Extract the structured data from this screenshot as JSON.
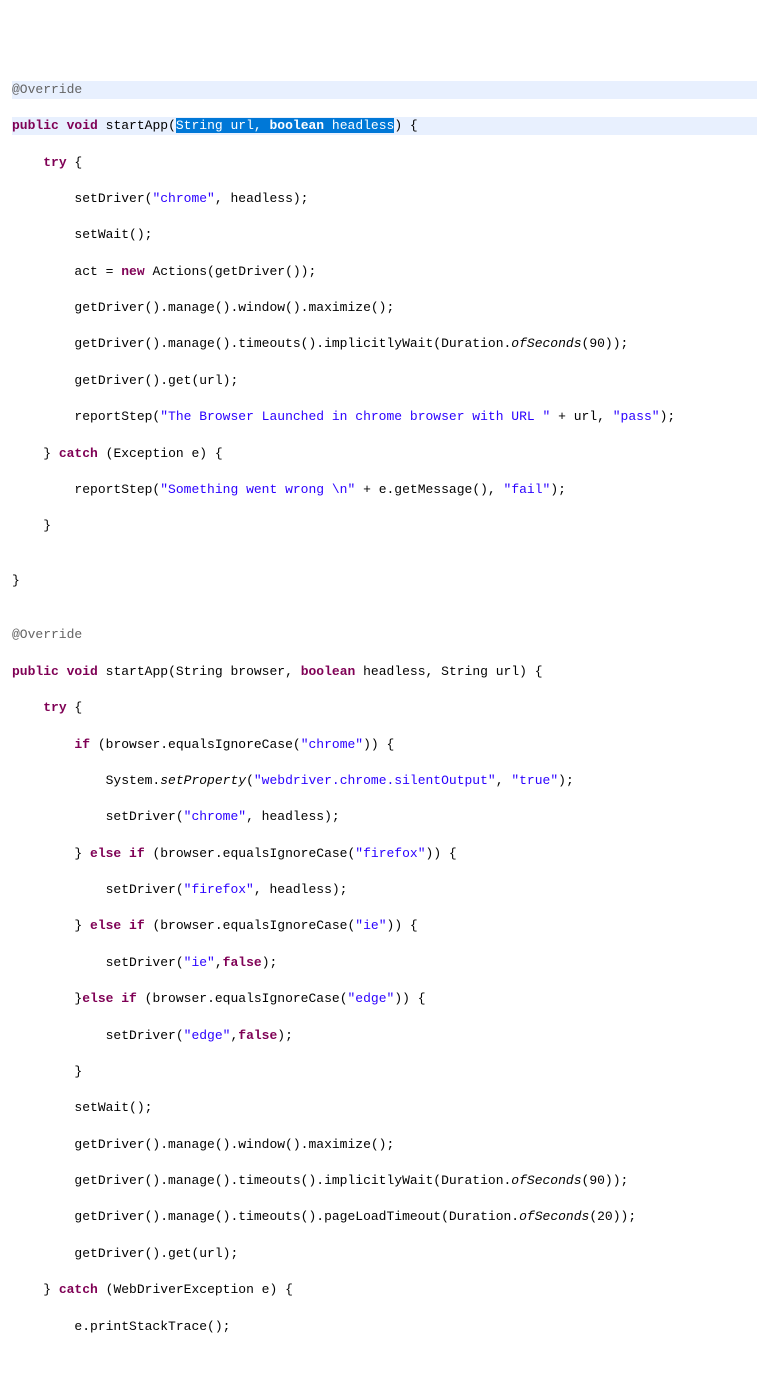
{
  "code": {
    "lines": [
      {
        "indent": 0,
        "tokens": [
          {
            "t": "annotation",
            "v": "@Override"
          }
        ],
        "firstLine": true
      },
      {
        "indent": 0,
        "tokens": [
          {
            "t": "keyword",
            "v": "public"
          },
          {
            "t": "sp",
            "v": " "
          },
          {
            "t": "keyword",
            "v": "void"
          },
          {
            "t": "sp",
            "v": " "
          },
          {
            "t": "method",
            "v": "startApp("
          },
          {
            "t": "selected",
            "v": "String url, "
          },
          {
            "t": "selected-keyword",
            "v": "boolean"
          },
          {
            "t": "selected",
            "v": " headless"
          },
          {
            "t": "method",
            "v": ") {"
          }
        ],
        "firstLine": true
      },
      {
        "indent": 1,
        "tokens": [
          {
            "t": "keyword",
            "v": "try"
          },
          {
            "t": "sp",
            "v": " {"
          }
        ]
      },
      {
        "indent": 2,
        "tokens": [
          {
            "t": "method",
            "v": "setDriver("
          },
          {
            "t": "string",
            "v": "\"chrome\""
          },
          {
            "t": "method",
            "v": ", headless);"
          }
        ]
      },
      {
        "indent": 2,
        "tokens": [
          {
            "t": "method",
            "v": "setWait();"
          }
        ]
      },
      {
        "indent": 2,
        "tokens": [
          {
            "t": "method",
            "v": "act = "
          },
          {
            "t": "keyword",
            "v": "new"
          },
          {
            "t": "sp",
            "v": " "
          },
          {
            "t": "method",
            "v": "Actions(getDriver());"
          }
        ]
      },
      {
        "indent": 2,
        "tokens": [
          {
            "t": "method",
            "v": "getDriver().manage().window().maximize();"
          }
        ]
      },
      {
        "indent": 2,
        "tokens": [
          {
            "t": "method",
            "v": "getDriver().manage().timeouts().implicitlyWait(Duration."
          },
          {
            "t": "static-call",
            "v": "ofSeconds"
          },
          {
            "t": "method",
            "v": "(90));"
          }
        ]
      },
      {
        "indent": 2,
        "tokens": [
          {
            "t": "method",
            "v": "getDriver().get(url);"
          }
        ]
      },
      {
        "indent": 2,
        "tokens": [
          {
            "t": "method",
            "v": "reportStep("
          },
          {
            "t": "string",
            "v": "\"The Browser Launched in chrome browser with URL \""
          },
          {
            "t": "method",
            "v": " + url, "
          },
          {
            "t": "string",
            "v": "\"pass\""
          },
          {
            "t": "method",
            "v": ");"
          }
        ]
      },
      {
        "indent": 1,
        "tokens": [
          {
            "t": "method",
            "v": "} "
          },
          {
            "t": "keyword",
            "v": "catch"
          },
          {
            "t": "sp",
            "v": " "
          },
          {
            "t": "method",
            "v": "(Exception e) {"
          }
        ]
      },
      {
        "indent": 2,
        "tokens": [
          {
            "t": "method",
            "v": "reportStep("
          },
          {
            "t": "string",
            "v": "\"Something went wrong \\n\""
          },
          {
            "t": "method",
            "v": " + e.getMessage(), "
          },
          {
            "t": "string",
            "v": "\"fail\""
          },
          {
            "t": "method",
            "v": ");"
          }
        ]
      },
      {
        "indent": 1,
        "tokens": [
          {
            "t": "method",
            "v": "}"
          }
        ]
      },
      {
        "indent": 0,
        "tokens": []
      },
      {
        "indent": 0,
        "tokens": [
          {
            "t": "method",
            "v": "}"
          }
        ]
      },
      {
        "indent": 0,
        "tokens": []
      },
      {
        "indent": 0,
        "tokens": [
          {
            "t": "annotation",
            "v": "@Override"
          }
        ]
      },
      {
        "indent": 0,
        "tokens": [
          {
            "t": "keyword",
            "v": "public"
          },
          {
            "t": "sp",
            "v": " "
          },
          {
            "t": "keyword",
            "v": "void"
          },
          {
            "t": "sp",
            "v": " "
          },
          {
            "t": "method",
            "v": "startApp(String browser, "
          },
          {
            "t": "keyword",
            "v": "boolean"
          },
          {
            "t": "sp",
            "v": " "
          },
          {
            "t": "method",
            "v": "headless, String url) {"
          }
        ]
      },
      {
        "indent": 1,
        "tokens": [
          {
            "t": "keyword",
            "v": "try"
          },
          {
            "t": "sp",
            "v": " {"
          }
        ]
      },
      {
        "indent": 2,
        "tokens": [
          {
            "t": "keyword",
            "v": "if"
          },
          {
            "t": "sp",
            "v": " "
          },
          {
            "t": "method",
            "v": "(browser.equalsIgnoreCase("
          },
          {
            "t": "string",
            "v": "\"chrome\""
          },
          {
            "t": "method",
            "v": ")) {"
          }
        ]
      },
      {
        "indent": 3,
        "tokens": [
          {
            "t": "method",
            "v": "System."
          },
          {
            "t": "static-call",
            "v": "setProperty"
          },
          {
            "t": "method",
            "v": "("
          },
          {
            "t": "string",
            "v": "\"webdriver.chrome.silentOutput\""
          },
          {
            "t": "method",
            "v": ", "
          },
          {
            "t": "string",
            "v": "\"true\""
          },
          {
            "t": "method",
            "v": ");"
          }
        ]
      },
      {
        "indent": 3,
        "tokens": [
          {
            "t": "method",
            "v": "setDriver("
          },
          {
            "t": "string",
            "v": "\"chrome\""
          },
          {
            "t": "method",
            "v": ", headless);"
          }
        ]
      },
      {
        "indent": 2,
        "tokens": [
          {
            "t": "method",
            "v": "} "
          },
          {
            "t": "keyword",
            "v": "else if"
          },
          {
            "t": "sp",
            "v": " "
          },
          {
            "t": "method",
            "v": "(browser.equalsIgnoreCase("
          },
          {
            "t": "string",
            "v": "\"firefox\""
          },
          {
            "t": "method",
            "v": ")) {"
          }
        ]
      },
      {
        "indent": 3,
        "tokens": [
          {
            "t": "method",
            "v": "setDriver("
          },
          {
            "t": "string",
            "v": "\"firefox\""
          },
          {
            "t": "method",
            "v": ", headless);"
          }
        ]
      },
      {
        "indent": 2,
        "tokens": [
          {
            "t": "method",
            "v": "} "
          },
          {
            "t": "keyword",
            "v": "else if"
          },
          {
            "t": "sp",
            "v": " "
          },
          {
            "t": "method",
            "v": "(browser.equalsIgnoreCase("
          },
          {
            "t": "string",
            "v": "\"ie\""
          },
          {
            "t": "method",
            "v": ")) {"
          }
        ]
      },
      {
        "indent": 3,
        "tokens": [
          {
            "t": "method",
            "v": "setDriver("
          },
          {
            "t": "string",
            "v": "\"ie\""
          },
          {
            "t": "method",
            "v": ","
          },
          {
            "t": "keyword",
            "v": "false"
          },
          {
            "t": "method",
            "v": ");"
          }
        ]
      },
      {
        "indent": 2,
        "tokens": [
          {
            "t": "method",
            "v": "}"
          },
          {
            "t": "keyword",
            "v": "else if"
          },
          {
            "t": "sp",
            "v": " "
          },
          {
            "t": "method",
            "v": "(browser.equalsIgnoreCase("
          },
          {
            "t": "string",
            "v": "\"edge\""
          },
          {
            "t": "method",
            "v": ")) {"
          }
        ]
      },
      {
        "indent": 3,
        "tokens": [
          {
            "t": "method",
            "v": "setDriver("
          },
          {
            "t": "string",
            "v": "\"edge\""
          },
          {
            "t": "method",
            "v": ","
          },
          {
            "t": "keyword",
            "v": "false"
          },
          {
            "t": "method",
            "v": ");"
          }
        ]
      },
      {
        "indent": 2,
        "tokens": [
          {
            "t": "method",
            "v": "}"
          }
        ]
      },
      {
        "indent": 2,
        "tokens": [
          {
            "t": "method",
            "v": "setWait();"
          }
        ]
      },
      {
        "indent": 2,
        "tokens": [
          {
            "t": "method",
            "v": "getDriver().manage().window().maximize();"
          }
        ]
      },
      {
        "indent": 2,
        "tokens": [
          {
            "t": "method",
            "v": "getDriver().manage().timeouts().implicitlyWait(Duration."
          },
          {
            "t": "static-call",
            "v": "ofSeconds"
          },
          {
            "t": "method",
            "v": "(90));"
          }
        ]
      },
      {
        "indent": 2,
        "tokens": [
          {
            "t": "method",
            "v": "getDriver().manage().timeouts().pageLoadTimeout(Duration."
          },
          {
            "t": "static-call",
            "v": "ofSeconds"
          },
          {
            "t": "method",
            "v": "(20));"
          }
        ]
      },
      {
        "indent": 2,
        "tokens": [
          {
            "t": "method",
            "v": "getDriver().get(url);"
          }
        ]
      },
      {
        "indent": 1,
        "tokens": [
          {
            "t": "method",
            "v": "} "
          },
          {
            "t": "keyword",
            "v": "catch"
          },
          {
            "t": "sp",
            "v": " "
          },
          {
            "t": "method",
            "v": "(WebDriverException e) {"
          }
        ]
      },
      {
        "indent": 2,
        "tokens": [
          {
            "t": "method",
            "v": "e.printStackTrace();"
          }
        ]
      }
    ],
    "indentUnit": "    "
  }
}
